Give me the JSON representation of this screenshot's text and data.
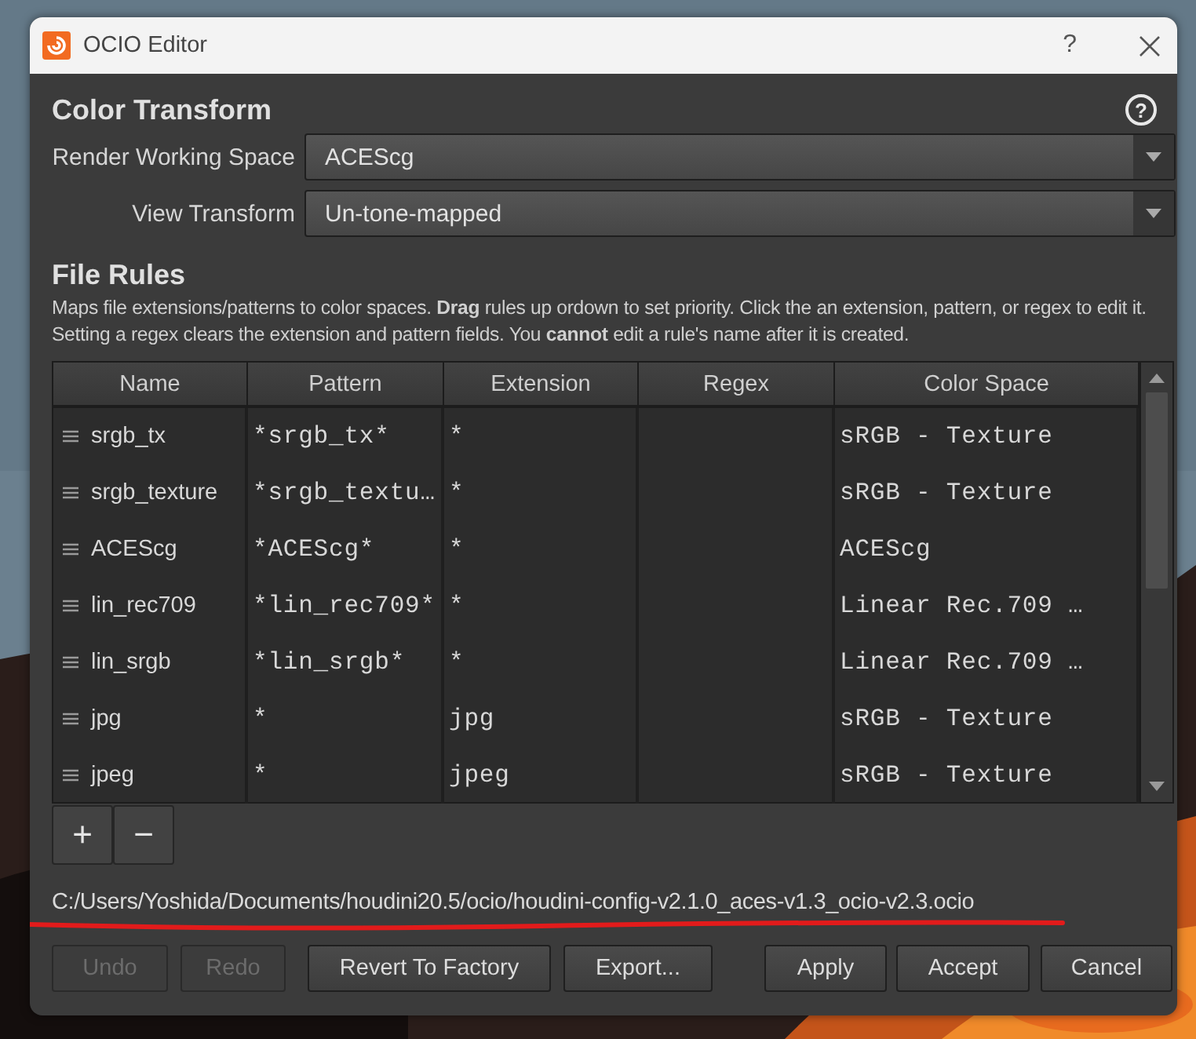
{
  "window": {
    "title": "OCIO Editor",
    "help": "?"
  },
  "color_transform": {
    "heading": "Color Transform",
    "help": "?",
    "fields": [
      {
        "label": "Render Working Space",
        "value": "ACEScg"
      },
      {
        "label": "View Transform",
        "value": "Un-tone-mapped"
      }
    ]
  },
  "file_rules": {
    "heading": "File Rules",
    "description": "Maps file extensions/patterns to color spaces. **Drag** rules up ordown to set priority. Click the an extension, pattern, or regex to edit it. Setting a regex clears the extension and pattern fields. You **cannot** edit a rule's name after it is created.",
    "table": {
      "columns": [
        "Name",
        "Pattern",
        "Extension",
        "Regex",
        "Color Space"
      ],
      "rows": [
        {
          "name": "srgb_tx",
          "pattern": "*srgb_tx*",
          "extension": "*",
          "color_space": "sRGB - Texture"
        },
        {
          "name": "srgb_texture",
          "pattern": "*srgb_textu…",
          "extension": "*",
          "color_space": "sRGB - Texture"
        },
        {
          "name": "ACEScg",
          "pattern": "*ACEScg*",
          "extension": "*",
          "color_space": "ACEScg"
        },
        {
          "name": "lin_rec709",
          "pattern": "*lin_rec709*",
          "extension": "*",
          "color_space": "Linear Rec.709 …"
        },
        {
          "name": "lin_srgb",
          "pattern": "*lin_srgb*",
          "extension": "*",
          "color_space": "Linear Rec.709 …"
        },
        {
          "name": "jpg",
          "pattern": "*",
          "extension": "jpg",
          "color_space": "sRGB - Texture"
        },
        {
          "name": "jpeg",
          "pattern": "*",
          "extension": "jpeg",
          "color_space": "sRGB - Texture"
        }
      ]
    },
    "row_buttons": [
      "+",
      "−"
    ]
  },
  "config_path": "C:/Users/Yoshida/Documents/houdini20.5/ocio/houdini-config-v2.1.0_aces-v1.3_ocio-v2.3.ocio",
  "edit_buttons": [
    {
      "label": "Undo",
      "disabled": true
    },
    {
      "label": "Redo",
      "disabled": true
    },
    {
      "label": "Revert To Factory",
      "disabled": false
    },
    {
      "label": "Export...",
      "disabled": false
    }
  ],
  "dialog_buttons": [
    {
      "label": "Apply",
      "disabled": false
    },
    {
      "label": "Accept",
      "disabled": false
    },
    {
      "label": "Cancel",
      "disabled": false
    }
  ]
}
